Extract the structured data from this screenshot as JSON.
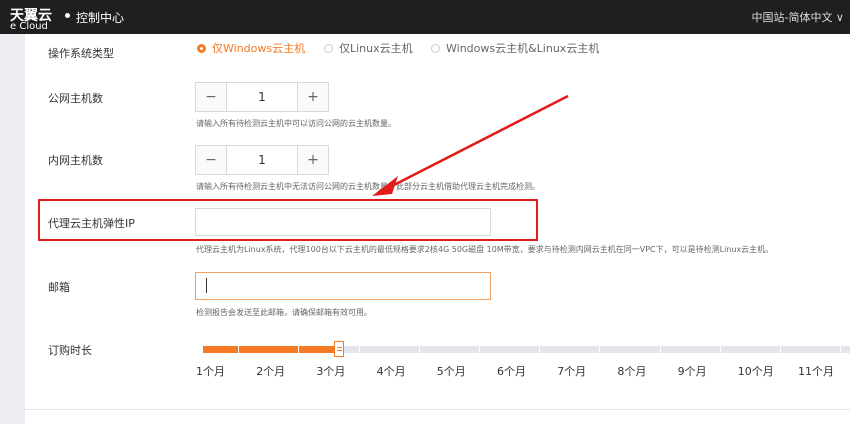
{
  "header": {
    "brand_cn": "天翼云",
    "brand_en": "e Cloud",
    "title": "控制中心",
    "region": "中国站-简体中文 ∨"
  },
  "os_type": {
    "label": "操作系统类型",
    "options": [
      "仅Windows云主机",
      "仅Linux云主机",
      "Windows云主机&Linux云主机"
    ],
    "selected": "仅Windows云主机"
  },
  "public_hosts": {
    "label": "公网主机数",
    "value": "1",
    "minus": "−",
    "plus": "+",
    "hint": "请输入所有待检测云主机中可以访问公网的云主机数量。"
  },
  "private_hosts": {
    "label": "内网主机数",
    "value": "1",
    "minus": "−",
    "plus": "+",
    "hint": "请输入所有待检测云主机中无法访问公网的云主机数量，此部分云主机借助代理云主机完成检测。"
  },
  "proxy_ip": {
    "label": "代理云主机弹性IP",
    "value": "",
    "hint": "代理云主机为Linux系统，代理100台以下云主机的最低规格要求2核4G 50G磁盘 10M带宽，要求与待检测内网云主机在同一VPC下，可以是待检测Linux云主机。"
  },
  "email": {
    "label": "邮箱",
    "value": "",
    "hint": "检测报告会发送至此邮箱，请确保邮箱有效可用。"
  },
  "duration": {
    "label": "订购时长",
    "ticks": [
      "1个月",
      "2个月",
      "3个月",
      "4个月",
      "5个月",
      "6个月",
      "7个月",
      "8个月",
      "9个月",
      "10个月",
      "11个月"
    ],
    "selected_months": 3
  },
  "colors": {
    "accent": "#f47a24",
    "annotation": "#e21b1b",
    "topbar": "#1f1f1f"
  }
}
